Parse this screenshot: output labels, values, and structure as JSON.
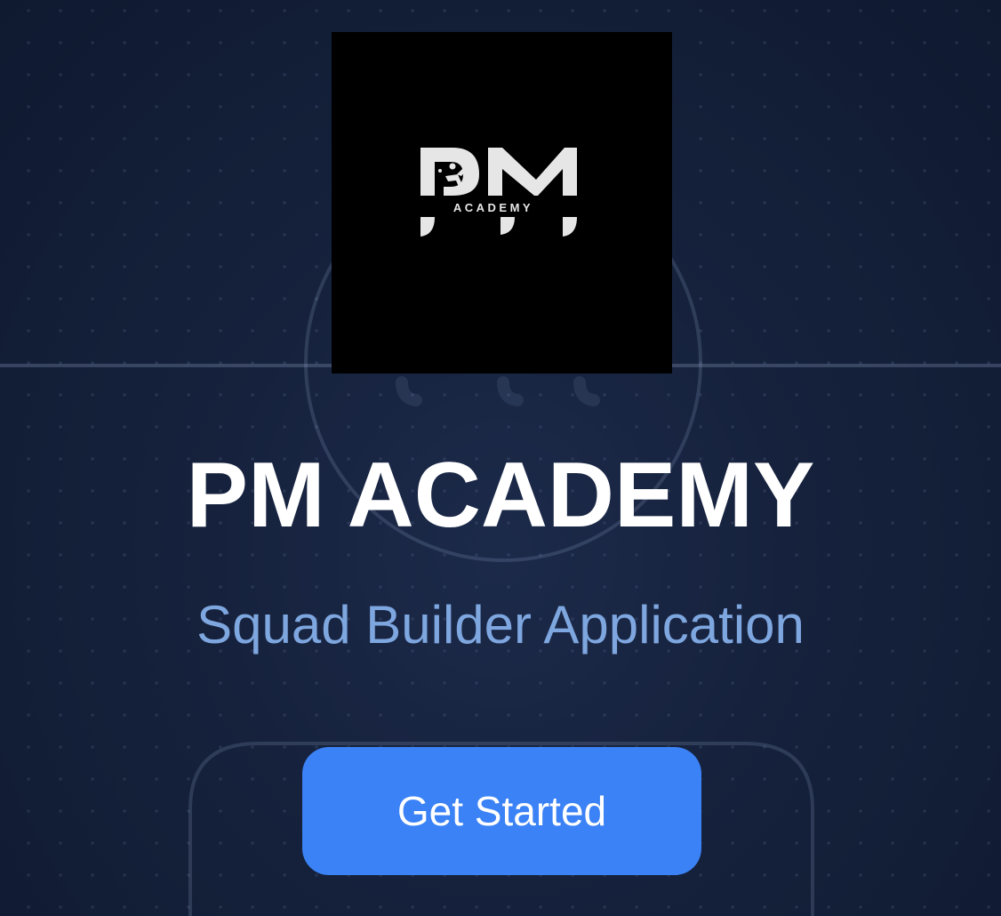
{
  "logo": {
    "monogram": "PM",
    "wordmark": "ACADEMY",
    "icon": "bicycle-kick-player-icon"
  },
  "hero": {
    "title": "PM ACADEMY",
    "subtitle": "Squad Builder Application"
  },
  "actions": {
    "get_started_label": "Get Started"
  },
  "colors": {
    "background": "#16223d",
    "accent": "#3b82f6",
    "subtitle": "#7ea6df",
    "title": "#ffffff",
    "logo_background": "#000000"
  }
}
